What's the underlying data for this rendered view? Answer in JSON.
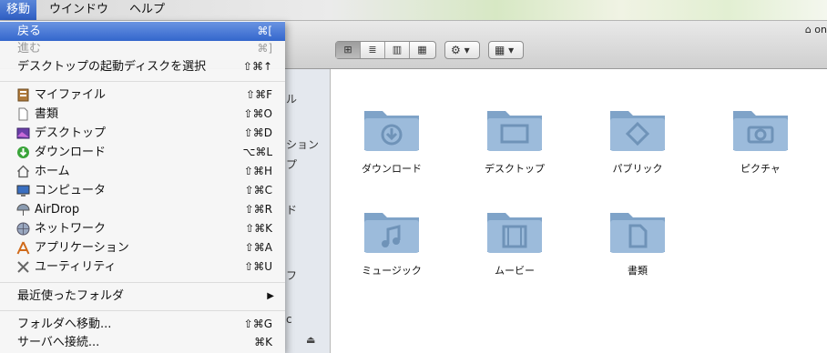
{
  "menubar": {
    "items": [
      {
        "label": "移動",
        "active": true
      },
      {
        "label": "ウインドウ",
        "active": false
      },
      {
        "label": "ヘルプ",
        "active": false
      }
    ]
  },
  "menu": {
    "items": [
      {
        "label": "戻る",
        "shortcut": "⌘[",
        "state": "highlighted"
      },
      {
        "label": "進む",
        "shortcut": "⌘]",
        "state": "disabled"
      },
      {
        "label": "デスクトップの起動ディスクを選択",
        "shortcut": "⇧⌘↑",
        "state": "normal"
      },
      {
        "label": "マイファイル",
        "shortcut": "⇧⌘F",
        "icon": "all-my-files-icon"
      },
      {
        "label": "書類",
        "shortcut": "⇧⌘O",
        "icon": "document-icon"
      },
      {
        "label": "デスクトップ",
        "shortcut": "⇧⌘D",
        "icon": "desktop-picture-icon"
      },
      {
        "label": "ダウンロード",
        "shortcut": "⌥⌘L",
        "icon": "download-icon"
      },
      {
        "label": "ホーム",
        "shortcut": "⇧⌘H",
        "icon": "home-icon"
      },
      {
        "label": "コンピュータ",
        "shortcut": "⇧⌘C",
        "icon": "computer-icon"
      },
      {
        "label": "AirDrop",
        "shortcut": "⇧⌘R",
        "icon": "airdrop-icon"
      },
      {
        "label": "ネットワーク",
        "shortcut": "⇧⌘K",
        "icon": "network-icon"
      },
      {
        "label": "アプリケーション",
        "shortcut": "⇧⌘A",
        "icon": "applications-icon"
      },
      {
        "label": "ユーティリティ",
        "shortcut": "⇧⌘U",
        "icon": "utilities-icon"
      },
      {
        "label": "最近使ったフォルダ",
        "submenu_arrow": "▶"
      },
      {
        "label": "フォルダへ移動...",
        "shortcut": "⇧⌘G"
      },
      {
        "label": "サーバへ接続...",
        "shortcut": "⌘K"
      }
    ]
  },
  "window": {
    "path_crumb": "on",
    "toolbar": {
      "view_buttons": [
        "⊞",
        "≣",
        "▥",
        "▦"
      ],
      "action_button": "⚙ ▾",
      "arrange_button": "▦ ▾"
    },
    "sidebar_fragments": [
      "ル",
      "ション",
      "プ",
      "ド",
      "フ",
      "c"
    ],
    "folders": [
      {
        "label": "ダウンロード",
        "icon": "download-folder-icon"
      },
      {
        "label": "デスクトップ",
        "icon": "desktop-folder-icon"
      },
      {
        "label": "パブリック",
        "icon": "public-folder-icon"
      },
      {
        "label": "ピクチャ",
        "icon": "pictures-folder-icon"
      },
      {
        "label": "ミュージック",
        "icon": "music-folder-icon"
      },
      {
        "label": "ムービー",
        "icon": "movies-folder-icon"
      },
      {
        "label": "書類",
        "icon": "documents-folder-icon"
      }
    ]
  },
  "colors": {
    "highlight": "#3366cc",
    "folder_blue": "#8aaed2"
  }
}
